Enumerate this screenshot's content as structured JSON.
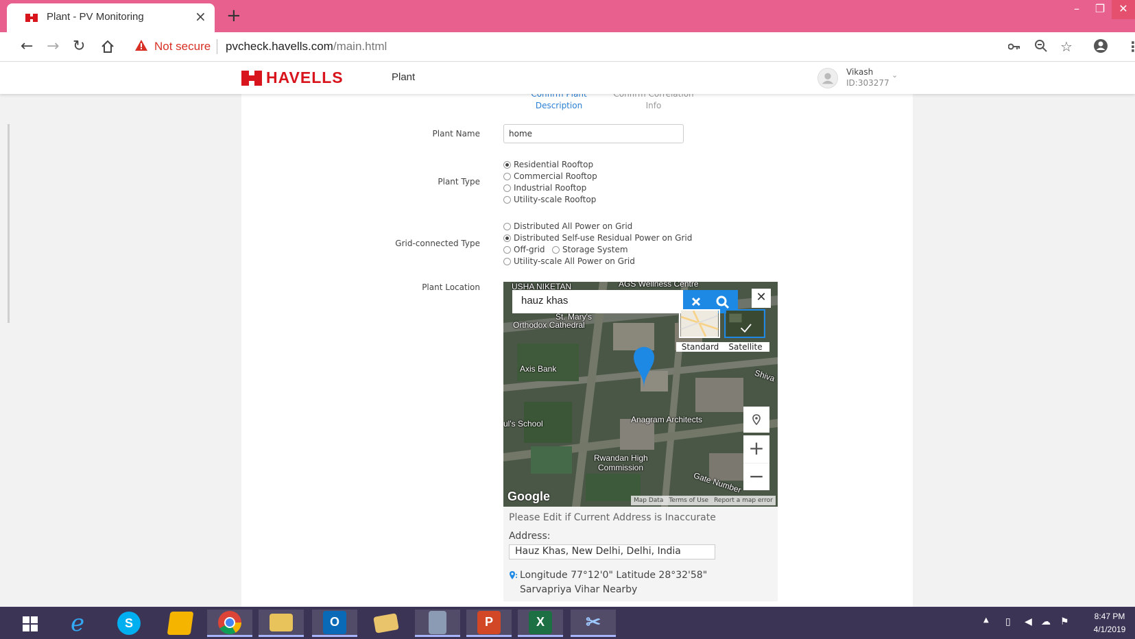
{
  "browser": {
    "tab_title": "Plant - PV Monitoring",
    "tab_close": "×",
    "new_tab": "+",
    "security_label": "Not secure",
    "url_host": "pvcheck.havells.com",
    "url_path": "/main.html"
  },
  "app": {
    "brand": "HAVELLS",
    "nav_item": "Plant",
    "user": {
      "name": "Vikash",
      "id": "ID:303277"
    }
  },
  "steps": [
    {
      "line1": "Confirm Plant",
      "line2": "Description"
    },
    {
      "line1": "Confirm Correlation",
      "line2": "Info"
    }
  ],
  "form": {
    "plant_name": {
      "label": "Plant Name",
      "value": "home"
    },
    "plant_type": {
      "label": "Plant Type",
      "options": [
        "Residential Rooftop",
        "Commercial Rooftop",
        "Industrial Rooftop",
        "Utility-scale Rooftop"
      ],
      "selected": "Residential Rooftop"
    },
    "grid_type": {
      "label": "Grid-connected Type",
      "options": [
        "Distributed All Power on Grid",
        "Distributed Self-use Residual Power on Grid",
        "Off-grid",
        "Storage System",
        "Utility-scale All Power on Grid"
      ],
      "selected": "Distributed Self-use Residual Power on Grid"
    },
    "location": {
      "label": "Plant Location",
      "search_value": "hauz khas",
      "map_types": [
        "Standard",
        "Satellite"
      ],
      "map_labels": [
        "USHA NIKETAN",
        "AGS Wellness Centre",
        "St. Mary's",
        "Orthodox Cathedral",
        "Axis Bank",
        "ul's School",
        "Anagram Architects",
        "Rwandan High",
        "Commission",
        "Gate Number",
        "Shiva"
      ],
      "google": "Google",
      "footer": [
        "Map Data",
        "Terms of Use",
        "Report a map error"
      ],
      "address_note": "Please Edit if Current Address is Inaccurate",
      "address_label": "Address:",
      "address_value": "Hauz Khas, New Delhi, Delhi, India",
      "coords_text": "Longitude 77°12'0\" Latitude 28°32'58\" Sarvapriya Vihar Nearby"
    }
  },
  "taskbar": {
    "time": "8:47 PM",
    "date": "4/1/2019"
  }
}
